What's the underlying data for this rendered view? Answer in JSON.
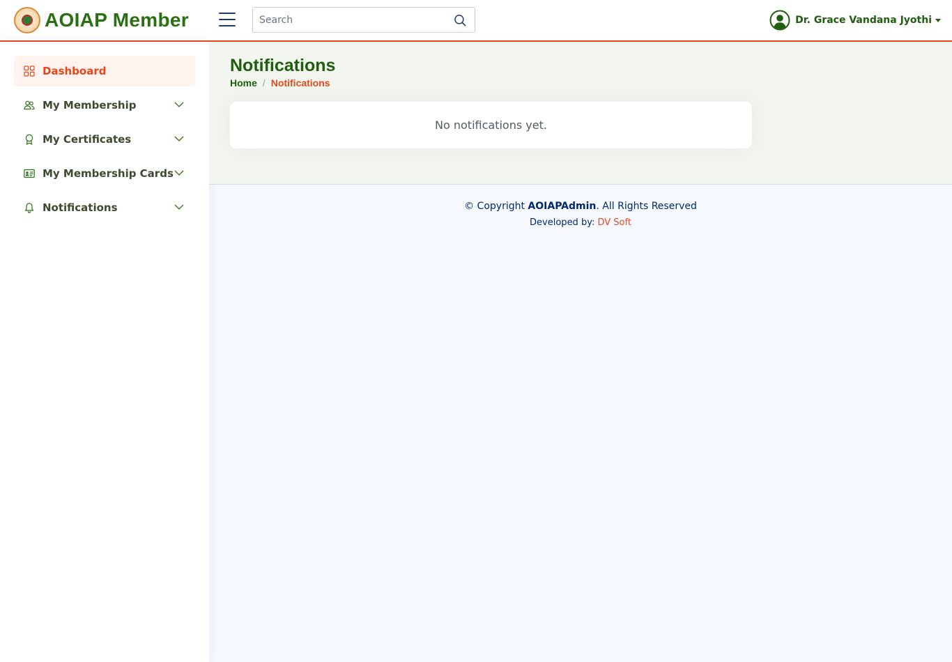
{
  "header": {
    "app_title": "AOIAP Member",
    "search": {
      "placeholder": "Search",
      "value": ""
    },
    "user_name": "Dr. Grace Vandana Jyothi"
  },
  "sidebar": {
    "items": [
      {
        "label": "Dashboard",
        "icon": "grid-icon",
        "active": true,
        "expandable": false
      },
      {
        "label": "My Membership",
        "icon": "people-icon",
        "active": false,
        "expandable": true
      },
      {
        "label": "My Certificates",
        "icon": "award-icon",
        "active": false,
        "expandable": true
      },
      {
        "label": "My Membership Cards",
        "icon": "person-card-icon",
        "active": false,
        "expandable": true
      },
      {
        "label": "Notifications",
        "icon": "bell-icon",
        "active": false,
        "expandable": true
      }
    ]
  },
  "main": {
    "page_title": "Notifications",
    "breadcrumb": {
      "home": "Home",
      "separator": "/",
      "current": "Notifications"
    },
    "empty_message": "No notifications yet."
  },
  "footer": {
    "copyright_prefix": "© Copyright ",
    "brand": "AOIAPAdmin",
    "copyright_suffix": ". All Rights Reserved",
    "developed_by": "Developed by: ",
    "developer": "DV Soft"
  },
  "colors": {
    "brand_green": "#1f5e0f",
    "accent_orange": "#e8471a",
    "nav_blue": "#012970"
  }
}
